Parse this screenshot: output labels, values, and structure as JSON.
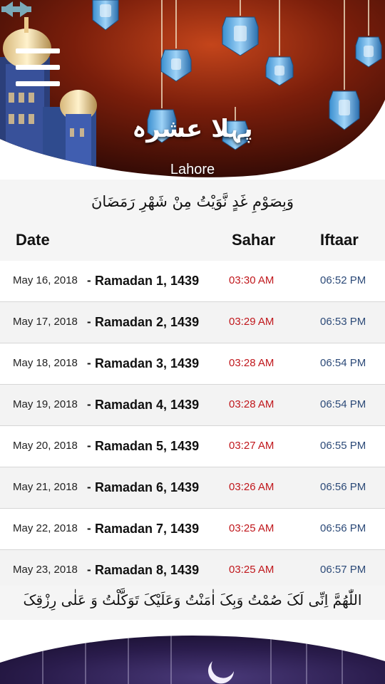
{
  "header": {
    "ashra_title": "پہلا عشرہ",
    "city": "Lahore",
    "menu_icon": "hamburger-menu-icon",
    "prev_icon": "arrow-left-icon",
    "next_icon": "arrow-right-icon"
  },
  "sehri_dua": "وَبِصَوْمِ غَدٍ نَّوَيْتُ مِنْ شَهْرِ رَمَضَانَ",
  "table": {
    "columns": {
      "date": "Date",
      "sahar": "Sahar",
      "iftaar": "Iftaar"
    },
    "separator": "-",
    "rows": [
      {
        "date": "May 16, 2018",
        "ramadan": "Ramadan 1, 1439",
        "sahar": "03:30 AM",
        "iftaar": "06:52 PM"
      },
      {
        "date": "May 17, 2018",
        "ramadan": "Ramadan 2, 1439",
        "sahar": "03:29 AM",
        "iftaar": "06:53 PM"
      },
      {
        "date": "May 18, 2018",
        "ramadan": "Ramadan 3, 1439",
        "sahar": "03:28 AM",
        "iftaar": "06:54 PM"
      },
      {
        "date": "May 19, 2018",
        "ramadan": "Ramadan 4, 1439",
        "sahar": "03:28 AM",
        "iftaar": "06:54 PM"
      },
      {
        "date": "May 20, 2018",
        "ramadan": "Ramadan 5, 1439",
        "sahar": "03:27 AM",
        "iftaar": "06:55 PM"
      },
      {
        "date": "May 21, 2018",
        "ramadan": "Ramadan 6, 1439",
        "sahar": "03:26 AM",
        "iftaar": "06:56 PM"
      },
      {
        "date": "May 22, 2018",
        "ramadan": "Ramadan 7, 1439",
        "sahar": "03:25 AM",
        "iftaar": "06:56 PM"
      },
      {
        "date": "May 23, 2018",
        "ramadan": "Ramadan 8, 1439",
        "sahar": "03:25 AM",
        "iftaar": "06:57 PM"
      }
    ]
  },
  "iftar_dua": "اللّٰهُمَّ اِنِّی لَکَ صُمْتُ وَبِکَ اٰمَنْتُ وَعَلَیْکَ تَوَکَّلْتُ وَ عَلٰی رِزْقِکَ اَفْطَرْتُ",
  "colors": {
    "sahar": "#c0171c",
    "iftaar": "#2c4a78",
    "header_bg": "#6e1a0a",
    "arrow": "#7aa9b8"
  }
}
